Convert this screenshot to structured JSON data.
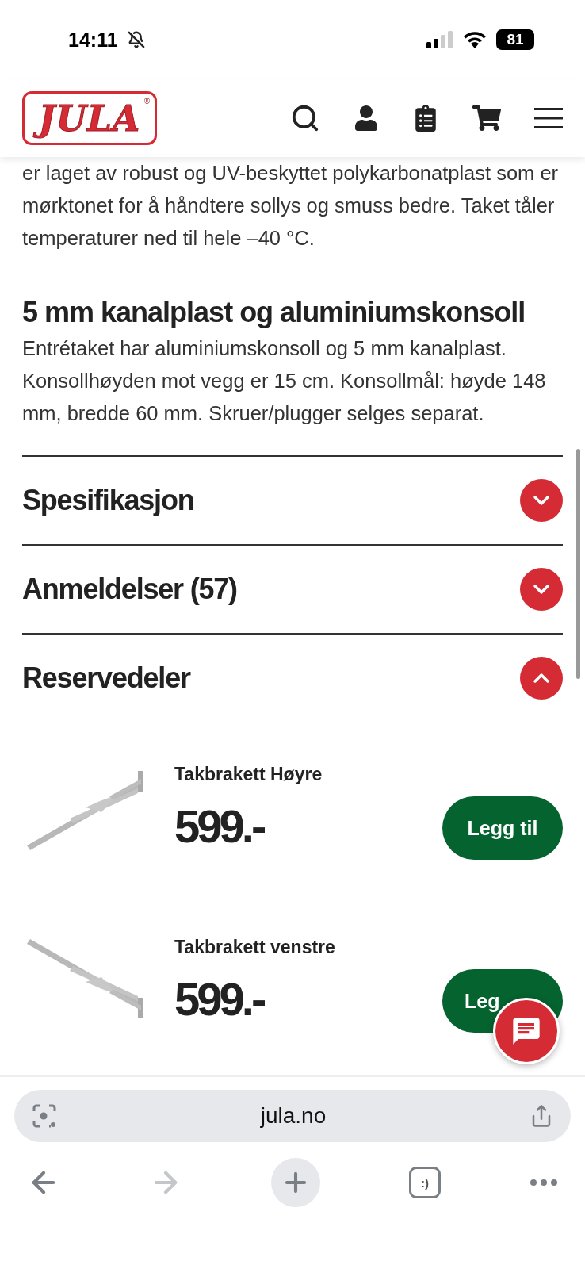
{
  "status_bar": {
    "time": "14:11",
    "battery": "81"
  },
  "header": {
    "logo": "JULA",
    "logo_mark": "®"
  },
  "intro_text": "er laget av robust og UV-beskyttet polykarbonatplast som er mørktonet for å håndtere sollys og smuss bedre. Taket tåler temperaturer ned til hele –40 °C.",
  "section": {
    "title": "5 mm kanalplast og aluminiumskonsoll",
    "text": "Entrétaket har aluminiumskonsoll og 5 mm kanalplast. Konsollhøyden mot vegg er 15 cm. Konsollmål: høyde 148 mm, bredde 60 mm. Skruer/plugger selges separat."
  },
  "accordion": [
    {
      "title": "Spesifikasjon",
      "expanded": false
    },
    {
      "title": "Anmeldelser (57)",
      "expanded": false
    },
    {
      "title": "Reservedeler",
      "expanded": true
    }
  ],
  "spare_parts": [
    {
      "name": "Takbrakett Høyre",
      "price": "599.-",
      "button": "Legg til",
      "kind": "right"
    },
    {
      "name": "Takbrakett venstre",
      "price": "599.-",
      "button": "Leg",
      "kind": "left"
    }
  ],
  "browser": {
    "url": "jula.no",
    "tabs_label": ":)"
  }
}
